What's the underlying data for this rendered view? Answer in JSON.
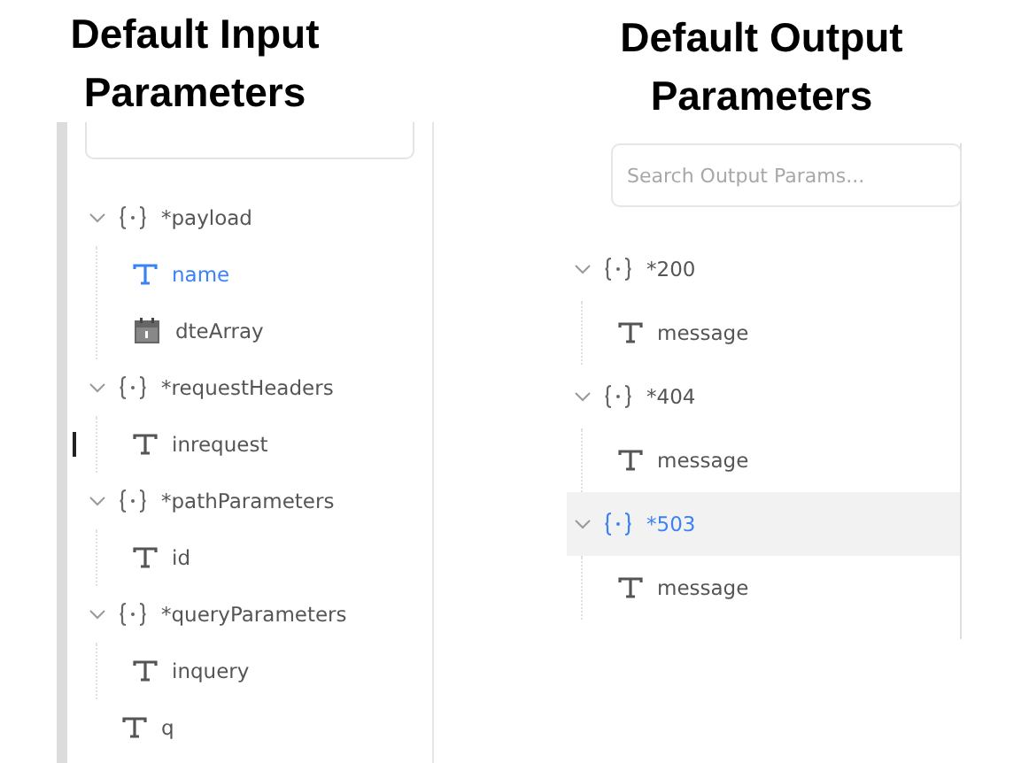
{
  "input_panel": {
    "heading": "Default Input Parameters",
    "tree": [
      {
        "kind": "object",
        "label": "*payload",
        "expanded": true,
        "selected": false,
        "children": [
          {
            "kind": "text",
            "label": "name",
            "selected": true
          },
          {
            "kind": "date",
            "label": "dteArray",
            "selected": false
          }
        ]
      },
      {
        "kind": "object",
        "label": "*requestHeaders",
        "expanded": true,
        "selected": false,
        "children": [
          {
            "kind": "text",
            "label": "inrequest",
            "selected": false,
            "cursor": true
          }
        ]
      },
      {
        "kind": "object",
        "label": "*pathParameters",
        "expanded": true,
        "selected": false,
        "children": [
          {
            "kind": "text",
            "label": "id",
            "selected": false
          }
        ]
      },
      {
        "kind": "object",
        "label": "*queryParameters",
        "expanded": true,
        "selected": false,
        "children": [
          {
            "kind": "text",
            "label": "inquery",
            "selected": false
          }
        ]
      },
      {
        "kind": "text",
        "label": "q",
        "selected": false
      }
    ]
  },
  "output_panel": {
    "heading": "Default Output Parameters",
    "search": {
      "placeholder": "Search Output Params..."
    },
    "tree": [
      {
        "kind": "object",
        "label": "*200",
        "expanded": true,
        "selected": false,
        "children": [
          {
            "kind": "text",
            "label": "message",
            "selected": false
          }
        ]
      },
      {
        "kind": "object",
        "label": "*404",
        "expanded": true,
        "selected": false,
        "children": [
          {
            "kind": "text",
            "label": "message",
            "selected": false
          }
        ]
      },
      {
        "kind": "object",
        "label": "*503",
        "expanded": true,
        "selected": true,
        "children": [
          {
            "kind": "text",
            "label": "message",
            "selected": false
          }
        ]
      }
    ]
  }
}
